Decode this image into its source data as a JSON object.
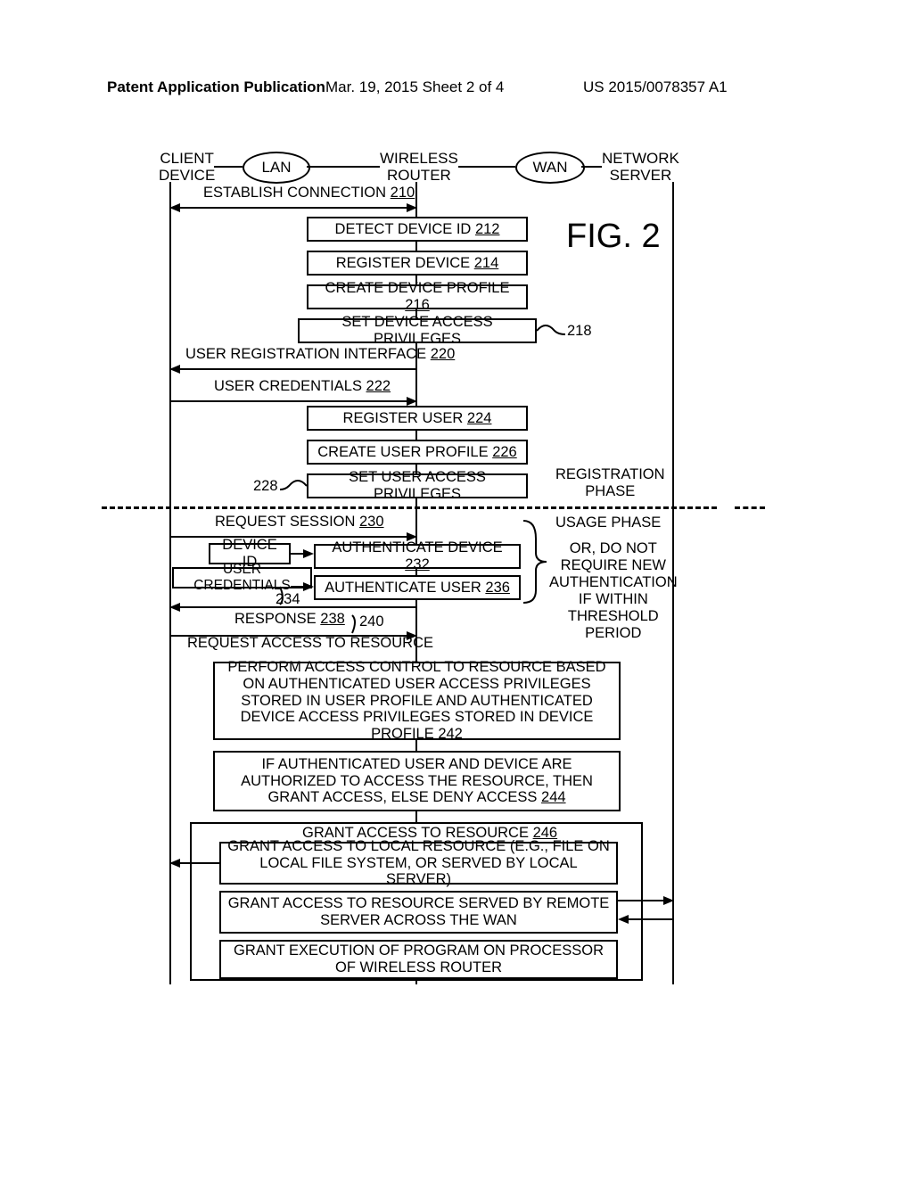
{
  "header": {
    "left": "Patent Application Publication",
    "center": "Mar. 19, 2015  Sheet 2 of 4",
    "right": "US 2015/0078357 A1"
  },
  "figure_label": "FIG. 2",
  "lanes": {
    "client": "CLIENT\nDEVICE",
    "lan": "LAN",
    "router": "WIRELESS\nROUTER",
    "wan": "WAN",
    "server": "NETWORK\nSERVER"
  },
  "messages": {
    "establish": "ESTABLISH CONNECTION",
    "establish_ref": "210",
    "user_reg_if": "USER REGISTRATION INTERFACE",
    "user_reg_if_ref": "220",
    "user_cred": "USER CREDENTIALS",
    "user_cred_ref": "222",
    "req_session": "REQUEST SESSION",
    "req_session_ref": "230",
    "device_id": "DEVICE ID",
    "user_cred2": "USER CREDENTIALS",
    "user_cred2_ref": "234",
    "response": "RESPONSE",
    "response_ref": "238",
    "req_access_res": "REQUEST ACCESS TO RESOURCE",
    "req_access_res_ref": "240"
  },
  "boxes": {
    "detect_device": "DETECT DEVICE ID",
    "detect_device_ref": "212",
    "register_device": "REGISTER DEVICE",
    "register_device_ref": "214",
    "create_dev_profile": "CREATE DEVICE PROFILE",
    "create_dev_profile_ref": "216",
    "set_dev_priv": "SET DEVICE ACCESS PRIVILEGES",
    "set_dev_priv_ref": "218",
    "register_user": "REGISTER USER",
    "register_user_ref": "224",
    "create_user_profile": "CREATE USER PROFILE",
    "create_user_profile_ref": "226",
    "set_user_priv": "SET USER ACCESS PRIVILEGES",
    "set_user_priv_ref": "228",
    "auth_device": "AUTHENTICATE DEVICE",
    "auth_device_ref": "232",
    "auth_user": "AUTHENTICATE USER",
    "auth_user_ref": "236",
    "perform_access": "PERFORM ACCESS CONTROL TO RESOURCE BASED ON AUTHENTICATED USER ACCESS PRIVILEGES STORED IN USER PROFILE AND AUTHENTICATED DEVICE ACCESS PRIVILEGES STORED IN DEVICE PROFILE",
    "perform_access_ref": "242",
    "if_authorized": "IF AUTHENTICATED USER AND DEVICE ARE AUTHORIZED TO ACCESS THE RESOURCE, THEN GRANT ACCESS, ELSE DENY ACCESS",
    "if_authorized_ref": "244",
    "grant_resource": "GRANT ACCESS TO RESOURCE",
    "grant_resource_ref": "246",
    "grant_local": "GRANT ACCESS TO LOCAL RESOURCE (E.G., FILE ON LOCAL FILE SYSTEM, OR SERVED BY LOCAL SERVER)",
    "grant_remote": "GRANT ACCESS TO RESOURCE SERVED BY REMOTE SERVER ACROSS THE WAN",
    "grant_exec": "GRANT EXECUTION OF PROGRAM ON PROCESSOR OF WIRELESS ROUTER"
  },
  "side": {
    "reg_phase": "REGISTRATION\nPHASE",
    "usage_phase": "USAGE PHASE",
    "or_note": "OR, DO NOT\nREQUIRE NEW\nAUTHENTICATION\nIF WITHIN\nTHRESHOLD\nPERIOD"
  }
}
